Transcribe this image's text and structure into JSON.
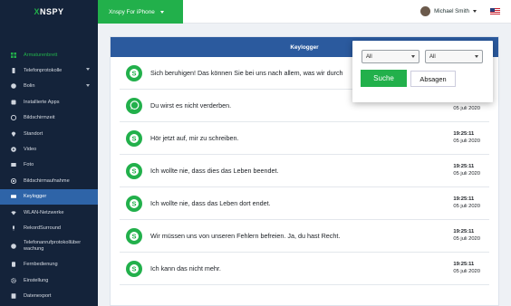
{
  "brand": {
    "prefix": "X",
    "name": "NSPY"
  },
  "sidebar": {
    "items": [
      {
        "label": "Armaturenbrett",
        "icon": "dashboard-icon"
      },
      {
        "label": "Telefonprotokolle",
        "icon": "phone-icon",
        "caret": true
      },
      {
        "label": "Bolin",
        "icon": "bubble-icon",
        "caret": true
      },
      {
        "label": "Installierte Apps",
        "icon": "apps-icon"
      },
      {
        "label": "Bildschirmzeit",
        "icon": "clock-icon"
      },
      {
        "label": "Standort",
        "icon": "location-icon"
      },
      {
        "label": "Video",
        "icon": "video-icon"
      },
      {
        "label": "Foto",
        "icon": "photo-icon"
      },
      {
        "label": "Bildschirmaufnahme",
        "icon": "record-icon"
      },
      {
        "label": "Keylogger",
        "icon": "keyboard-icon"
      },
      {
        "label": "WLAN-Netzwerke",
        "icon": "wifi-icon"
      },
      {
        "label": "RekordSurround",
        "icon": "mic-icon"
      },
      {
        "label": "Telefonanrufprotokollüber wachung",
        "icon": "call-log-icon"
      },
      {
        "label": "Fernbedienung",
        "icon": "remote-icon"
      },
      {
        "label": "Einstellung",
        "icon": "gear-icon"
      },
      {
        "label": "Datenexport",
        "icon": "export-icon"
      }
    ]
  },
  "header": {
    "device": "Xnspy For iPhone",
    "user_name": "Michael Smith"
  },
  "panel": {
    "title": "Keylogger",
    "rows": [
      {
        "app": "skype",
        "message": "Sich beruhigen! Das können Sie bei uns nach allem, was wir durch",
        "time": "19:25:11",
        "date": "05 juli 2020"
      },
      {
        "app": "whatsapp",
        "message": "Du wirst es nicht verderben.",
        "time": "19:25:11",
        "date": "05 juli 2020"
      },
      {
        "app": "skype",
        "message": "Hör jetzt auf, mir zu schreiben.",
        "time": "19:25:11",
        "date": "05 juli 2020"
      },
      {
        "app": "skype",
        "message": "Ich wollte nie, dass dies das Leben beendet.",
        "time": "19:25:11",
        "date": "05 juli 2020"
      },
      {
        "app": "skype",
        "message": "Ich wollte nie, dass das Leben dort endet.",
        "time": "19:25:11",
        "date": "05 juli 2020"
      },
      {
        "app": "skype",
        "message": "Wir müssen uns von unseren Fehlern befreien. Ja, du hast Recht.",
        "time": "19:25:11",
        "date": "05 juli 2020"
      },
      {
        "app": "skype",
        "message": "Ich kann das nicht mehr.",
        "time": "19:25:11",
        "date": "05 juli 2020"
      }
    ]
  },
  "filter": {
    "select1": "All",
    "select2": "All",
    "search_label": "Suche",
    "cancel_label": "Absagen"
  },
  "colors": {
    "accent": "#22b04b",
    "sidebar_bg": "#14233a",
    "header_blue": "#2b5a9e",
    "active_item": "#2e64a8"
  }
}
